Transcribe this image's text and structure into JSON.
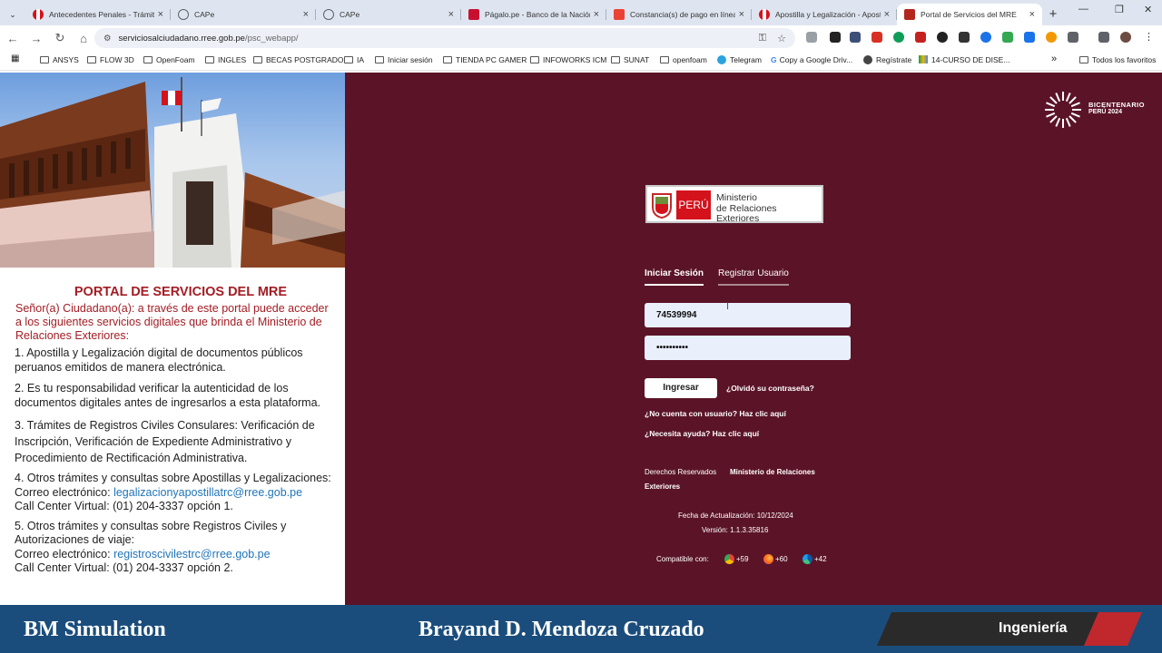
{
  "tabs": [
    {
      "title": "Antecedentes Penales - Trámite",
      "color": "#d4121c"
    },
    {
      "title": "CAPe",
      "color": "#5f6368"
    },
    {
      "title": "CAPe",
      "color": "#5f6368"
    },
    {
      "title": "Págalo.pe - Banco de la Nación",
      "color": "#c8102e"
    },
    {
      "title": "Constancia(s) de pago en línea",
      "color": "#ea4335"
    },
    {
      "title": "Apostilla y Legalización - Apost",
      "color": "#d4121c"
    },
    {
      "title": "Portal de Servicios del MRE",
      "color": "#b3261e"
    }
  ],
  "url": {
    "host": "serviciosalciudadano.rree.gob.pe",
    "path": "/psc_webapp/"
  },
  "bookmarks": [
    "ANSYS",
    "FLOW 3D",
    "OpenFoam",
    "INGLES",
    "BECAS POSTGRADO",
    "IA",
    "Iniciar sesión",
    "TIENDA PC GAMER",
    "INFOWORKS ICM",
    "SUNAT",
    "openfoam",
    "Telegram",
    "Copy a Google Driv...",
    "Regístrate",
    "14-CURSO DE DISE..."
  ],
  "all_bookmarks": "Todos los favoritos",
  "left": {
    "title": "PORTAL DE SERVICIOS DEL MRE",
    "intro": "Señor(a) Ciudadano(a): a través de este portal puede acceder a los siguientes servicios digitales que brinda el Ministerio de Relaciones Exteriores:",
    "item1": "1.  Apostilla y Legalización digital de documentos  públicos peruanos emitidos de manera electrónica.",
    "item2": "2.  Es tu responsabilidad verificar la autenticidad de los documentos digitales antes de ingresarlos a esta plataforma.",
    "item3": "3.  Trámites de Registros Civiles Consulares: Verificación de Inscripción, Verificación de Expediente Administrativo y Procedimiento de Rectificación Administrativa.",
    "item4_title": "4.  Otros trámites y consultas sobre Apostillas y Legalizaciones:",
    "item4_email_label": "Correo electrónico: ",
    "item4_email": "legalizacionyapostillatrc@rree.gob.pe",
    "item4_phone": "Call Center Virtual: (01) 204-3337 opción 1.",
    "item5_title": "5.  Otros trámites y consultas sobre Registros Civiles y Autorizaciones de viaje:",
    "item5_email_label": "Correo electrónico: ",
    "item5_email": "registroscivilestrc@rree.gob.pe",
    "item5_phone": "Call Center Virtual: (01) 204-3337 opción 2."
  },
  "right": {
    "bicentenario_1": "BICENTENARIO",
    "bicentenario_2": "PERÚ 2024",
    "logo_peru": "PERÚ",
    "logo_min_1": "Ministerio",
    "logo_min_2": "de Relaciones Exteriores",
    "tab_login": "Iniciar Sesión",
    "tab_register": "Registrar Usuario",
    "user_value": "74539994",
    "password_value": "••••••••••",
    "login_button": "Ingresar",
    "forgot": "¿Olvidó su contraseña?",
    "no_user": "¿No cuenta con usuario? Haz clic aquí",
    "help": "¿Necesita ayuda? Haz clic aquí",
    "rights": "Derechos Reservados",
    "rights_owner": "Ministerio de Relaciones",
    "rights_owner2": "Exteriores",
    "update": "Fecha de Actualización: 10/12/2024",
    "version": "Versión: 1.1.3.35816",
    "compatible": "Compatible con:",
    "chrome": "+59",
    "firefox": "+60",
    "edge": "+42"
  },
  "footer": {
    "left": "BM Simulation",
    "center": "Brayand D. Mendoza Cruzado",
    "right": "Ingeniería"
  }
}
